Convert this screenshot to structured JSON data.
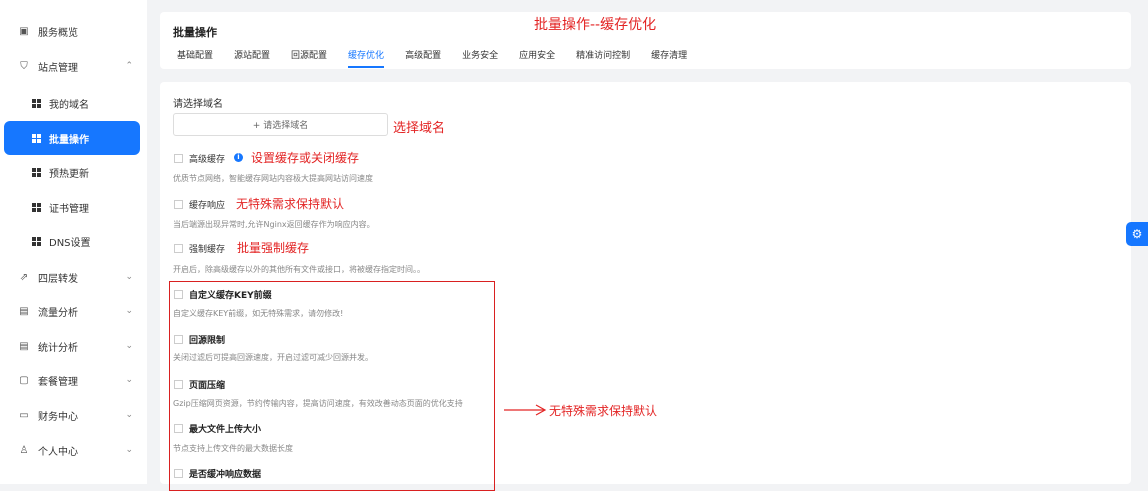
{
  "sidebar": {
    "items": [
      {
        "label": "服务概览",
        "icon": "chart-icon",
        "type": "top",
        "chevron": ""
      },
      {
        "label": "站点管理",
        "icon": "shield-icon",
        "type": "top",
        "chevron": "^"
      },
      {
        "label": "我的域名",
        "icon": "grid-icon",
        "type": "sub"
      },
      {
        "label": "批量操作",
        "icon": "grid-icon",
        "type": "sub",
        "active": true
      },
      {
        "label": "预热更新",
        "icon": "grid-icon",
        "type": "sub"
      },
      {
        "label": "证书管理",
        "icon": "grid-icon",
        "type": "sub"
      },
      {
        "label": "DNS设置",
        "icon": "grid-icon",
        "type": "sub"
      },
      {
        "label": "四层转发",
        "icon": "forward-icon",
        "type": "top",
        "chevron": "v"
      },
      {
        "label": "流量分析",
        "icon": "document-icon",
        "type": "top",
        "chevron": "v"
      },
      {
        "label": "统计分析",
        "icon": "document-icon",
        "type": "top",
        "chevron": "v"
      },
      {
        "label": "套餐管理",
        "icon": "package-icon",
        "type": "top",
        "chevron": "v"
      },
      {
        "label": "财务中心",
        "icon": "wallet-icon",
        "type": "top",
        "chevron": "v"
      },
      {
        "label": "个人中心",
        "icon": "user-icon",
        "type": "top",
        "chevron": "v"
      }
    ]
  },
  "header": {
    "title": "批量操作",
    "tabs": [
      "基础配置",
      "源站配置",
      "回源配置",
      "缓存优化",
      "高级配置",
      "业务安全",
      "应用安全",
      "精准访问控制",
      "缓存清理"
    ],
    "active_tab": "缓存优化"
  },
  "form": {
    "domain_label": "请选择域名",
    "domain_button": "+ 请选择域名",
    "options": [
      {
        "label": "高级缓存",
        "desc": "优质节点网络，智能缓存网站内容极大提高网站访问速度",
        "info": "i"
      },
      {
        "label": "缓存响应",
        "desc": "当后端源出现异常时,允许Nginx返回缓存作为响应内容。"
      },
      {
        "label": "强制缓存",
        "desc": "开启后，除高级缓存以外的其他所有文件或接口，将被缓存指定时间。。"
      }
    ],
    "boxed_options": [
      {
        "label": "自定义缓存KEY前缀",
        "desc": "自定义缓存KEY前缀，如无特殊需求，请勿修改!"
      },
      {
        "label": "回源限制",
        "desc": "关闭过滤后可提高回源速度，开启过滤可减少回源并发。"
      },
      {
        "label": "页面压缩",
        "desc": "Gzip压缩网页资源，节约传输内容，提高访问速度，有效改善动态页面的优化支持"
      },
      {
        "label": "最大文件上传大小",
        "desc": "节点支持上传文件的最大数据长度"
      },
      {
        "label": "是否缓冲响应数据",
        "desc": ""
      }
    ]
  },
  "annotations": {
    "title": "批量操作--缓存优化",
    "select_domain": "选择域名",
    "cache_toggle": "设置缓存或关闭缓存",
    "keep_default_1": "无特殊需求保持默认",
    "force_cache": "批量强制缓存",
    "keep_default_2": "无特殊需求保持默认",
    "color": "#e32424"
  },
  "float_button": {
    "icon": "gear-icon",
    "glyph": "⚙"
  }
}
